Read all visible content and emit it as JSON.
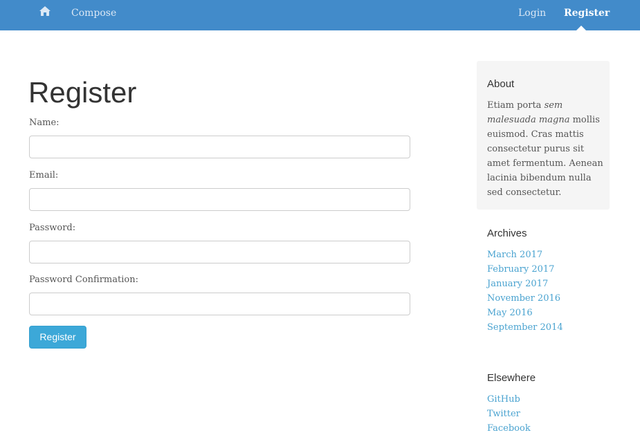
{
  "nav": {
    "home_icon": "home-icon",
    "compose": "Compose",
    "login": "Login",
    "register": "Register"
  },
  "main": {
    "title": "Register",
    "fields": [
      {
        "label": "Name:",
        "value": ""
      },
      {
        "label": "Email:",
        "value": ""
      },
      {
        "label": "Password:",
        "value": ""
      },
      {
        "label": "Password Confirmation:",
        "value": ""
      }
    ],
    "submit_label": "Register"
  },
  "sidebar": {
    "about": {
      "heading": "About",
      "text_pre": "Etiam porta ",
      "text_em": "sem malesuada magna",
      "text_post": " mollis euismod. Cras mattis consectetur purus sit amet fermentum. Aenean lacinia bibendum nulla sed consectetur."
    },
    "archives": {
      "heading": "Archives",
      "items": [
        "March 2017",
        "February 2017",
        "January 2017",
        "November 2016",
        "May 2016",
        "September 2014"
      ]
    },
    "elsewhere": {
      "heading": "Elsewhere",
      "items": [
        "GitHub",
        "Twitter",
        "Facebook"
      ]
    }
  },
  "colors": {
    "navbar": "#428bca",
    "link": "#4aa3d0",
    "button": "#3ca8d8",
    "about_bg": "#f5f5f5"
  }
}
